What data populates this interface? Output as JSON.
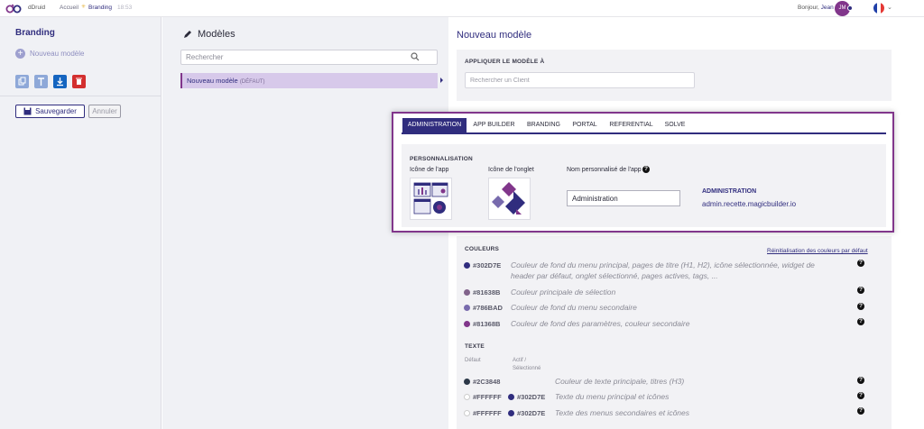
{
  "topbar": {
    "brand": "dDruid",
    "breadcrumbs": [
      "Accueil",
      "Branding",
      "18:53"
    ],
    "greeting": "Bonjour,",
    "user_name": "Jean",
    "avatar_initials": "JM"
  },
  "sidebar": {
    "title": "Branding",
    "new_model": "Nouveau modèle",
    "save": "Sauvegarder",
    "cancel": "Annuler",
    "actions": [
      {
        "icon": "copy-icon",
        "color": "#8ea8d8"
      },
      {
        "icon": "upload-icon",
        "color": "#8ea8d8"
      },
      {
        "icon": "download-icon",
        "color": "#1565c0"
      },
      {
        "icon": "trash-icon",
        "color": "#d32f2f"
      }
    ]
  },
  "models": {
    "title": "Modèles",
    "search_placeholder": "Rechercher",
    "items": [
      {
        "name": "Nouveau modèle",
        "tag": "(DÉFAUT)"
      }
    ]
  },
  "editor": {
    "title": "Nouveau modèle",
    "apply_label": "APPLIQUER LE MODÈLE À",
    "client_placeholder": "Rechercher un Client",
    "tabs": [
      "ADMINISTRATION",
      "APP BUILDER",
      "BRANDING",
      "PORTAL",
      "REFERENTIAL",
      "SOLVE"
    ],
    "active_tab": "ADMINISTRATION",
    "personalisation": {
      "title": "PERSONNALISATION",
      "app_icon_label": "Icône de l'app",
      "tab_icon_label": "Icône de l'onglet",
      "custom_name_label": "Nom personnalisé de l'app",
      "custom_name_value": "Administration",
      "app_name": "ADMINISTRATION",
      "app_url": "admin.recette.magicbuilder.io"
    },
    "colors": {
      "title": "COULEURS",
      "reset": "Réinitialisation des couleurs par défaut",
      "items": [
        {
          "hex": "#302D7E",
          "line1": "Couleur de fond du menu principal, pages de titre (H1, H2), icône sélectionnée, widget de",
          "line2": "header par défaut, onglet sélectionné, pages actives, tags, ..."
        },
        {
          "hex": "#81638B",
          "line1": "Couleur principale de sélection",
          "line2": ""
        },
        {
          "hex": "#786BAD",
          "line1": "Couleur de fond du menu secondaire",
          "line2": ""
        },
        {
          "hex": "#81368B",
          "line1": "Couleur de fond des paramètres, couleur secondaire",
          "line2": ""
        }
      ]
    },
    "text": {
      "title": "TEXTE",
      "col_default": "Défaut",
      "col_active_1": "Actif /",
      "col_active_2": "Sélectionné",
      "items": [
        {
          "default_hex": "#2C3848",
          "active_hex": "",
          "desc": "Couleur de texte principale, titres (H3)"
        },
        {
          "default_hex": "#FFFFFF",
          "active_hex": "#302D7E",
          "desc": "Texte du menu principal et icônes"
        },
        {
          "default_hex": "#FFFFFF",
          "active_hex": "#302D7E",
          "desc": "Texte des menus secondaires et icônes"
        }
      ]
    }
  },
  "colors_theme": {
    "primary": "#302D7E",
    "accent": "#81368B",
    "selection": "#d7c9ea"
  }
}
